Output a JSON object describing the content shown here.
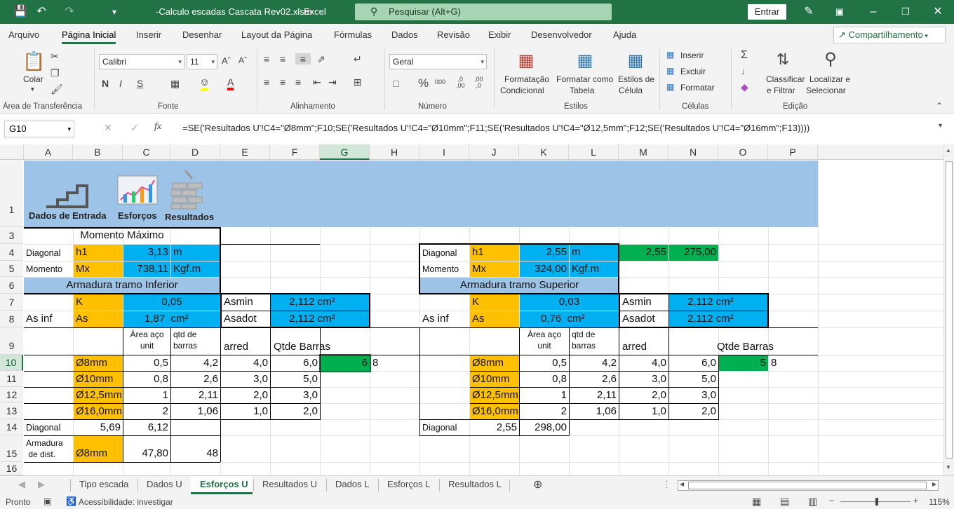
{
  "titlebar": {
    "filename": "-Calculo escadas Cascata Rev02.xlsm",
    "app": "Excel",
    "search_placeholder": "Pesquisar (Alt+G)",
    "signin": "Entrar"
  },
  "menu": {
    "tabs": [
      "Arquivo",
      "Página Inicial",
      "Inserir",
      "Desenhar",
      "Layout da Página",
      "Fórmulas",
      "Dados",
      "Revisão",
      "Exibir",
      "Desenvolvedor",
      "Ajuda"
    ],
    "share": "Compartilhamento"
  },
  "ribbon": {
    "paste": "Colar",
    "font_name": "Calibri",
    "font_size": "11",
    "number_format": "Geral",
    "cond_format": [
      "Formatação",
      "Condicional"
    ],
    "format_table": [
      "Formatar como",
      "Tabela"
    ],
    "cell_styles": [
      "Estilos de",
      "Célula"
    ],
    "insert": "Inserir",
    "delete": "Excluir",
    "format": "Formatar",
    "sort": [
      "Classificar",
      "e Filtrar"
    ],
    "find": [
      "Localizar e",
      "Selecionar"
    ],
    "groups": [
      "Área de Transferência",
      "Fonte",
      "Alinhamento",
      "Número",
      "Estilos",
      "Células",
      "Edição"
    ]
  },
  "formula_bar": {
    "namebox": "G10",
    "formula": "=SE('Resultados U'!C4=\"Ø8mm\";F10;SE('Resultados U'!C4=\"Ø10mm\";F11;SE('Resultados U'!C4=\"Ø12,5mm\";F12;SE('Resultados U'!C4=\"Ø16mm\";F13))))"
  },
  "columns": [
    "A",
    "B",
    "C",
    "D",
    "E",
    "F",
    "G",
    "H",
    "I",
    "J",
    "K",
    "L",
    "M",
    "N",
    "O",
    "P"
  ],
  "rows": [
    "1",
    "3",
    "4",
    "5",
    "6",
    "7",
    "8",
    "9",
    "10",
    "11",
    "12",
    "13",
    "14",
    "15",
    "16"
  ],
  "banner": {
    "btn1": "Dados de Entrada",
    "btn2": "Esforços",
    "btn3": "Resultados"
  },
  "left": {
    "title": "Momento Máximo",
    "r4": [
      "Diagonal",
      "h1",
      "3,13",
      "m"
    ],
    "r5": [
      "Momento",
      "Mx",
      "738,11",
      "Kgf.m"
    ],
    "r6": "Armadura tramo Inferior",
    "r7": [
      "K",
      "0,05",
      "Asmin",
      "2,112",
      "cm²"
    ],
    "r8": [
      "As inf",
      "As",
      "1,87",
      "cm²",
      "Asadot",
      "2,112",
      "cm²"
    ],
    "r9": [
      "Área aço",
      "unit",
      "qtd de",
      "barras",
      "arred",
      "Qtde Barras"
    ],
    "rows": [
      [
        "Ø8mm",
        "0,5",
        "4,2",
        "4,0",
        "6,0",
        "6",
        "8"
      ],
      [
        "Ø10mm",
        "0,8",
        "2,6",
        "3,0",
        "5,0"
      ],
      [
        "Ø12,5mm",
        "1",
        "2,11",
        "2,0",
        "3,0"
      ],
      [
        "Ø16,0mm",
        "2",
        "1,06",
        "1,0",
        "2,0"
      ]
    ],
    "r14": [
      "Diagonal",
      "5,69",
      "6,12"
    ],
    "r15": [
      "Armadura",
      "de dist.",
      "Ø8mm",
      "47,80",
      "48"
    ]
  },
  "right": {
    "r4": [
      "Diagonal",
      "h1",
      "2,55",
      "m",
      "2,55",
      "275,00"
    ],
    "r5": [
      "Momento",
      "Mx",
      "324,00",
      "Kgf.m"
    ],
    "r6": "Armadura tramo Superior",
    "r7": [
      "K",
      "0,03",
      "Asmin",
      "2,112",
      "cm²"
    ],
    "r8": [
      "As inf",
      "As",
      "0,76",
      "cm²",
      "Asadot",
      "2,112",
      "cm²"
    ],
    "r9": [
      "Área aço",
      "unit",
      "qtd de",
      "barras",
      "arred",
      "Qtde Barras"
    ],
    "rows": [
      [
        "Ø8mm",
        "0,5",
        "4,2",
        "4,0",
        "6,0",
        "5",
        "8"
      ],
      [
        "Ø10mm",
        "0,8",
        "2,6",
        "3,0",
        "5,0"
      ],
      [
        "Ø12,5mm",
        "1",
        "2,11",
        "2,0",
        "3,0"
      ],
      [
        "Ø16,0mm",
        "2",
        "1,06",
        "1,0",
        "2,0"
      ]
    ],
    "r14": [
      "Diagonal",
      "2,55",
      "298,00"
    ]
  },
  "sheets": [
    "Tipo escada",
    "Dados U",
    "Esforços U",
    "Resultados U",
    "Dados L",
    "Esforços L",
    "Resultados L"
  ],
  "status": {
    "ready": "Pronto",
    "accessibility": "Acessibilidade: investigar",
    "zoom": "115%"
  }
}
